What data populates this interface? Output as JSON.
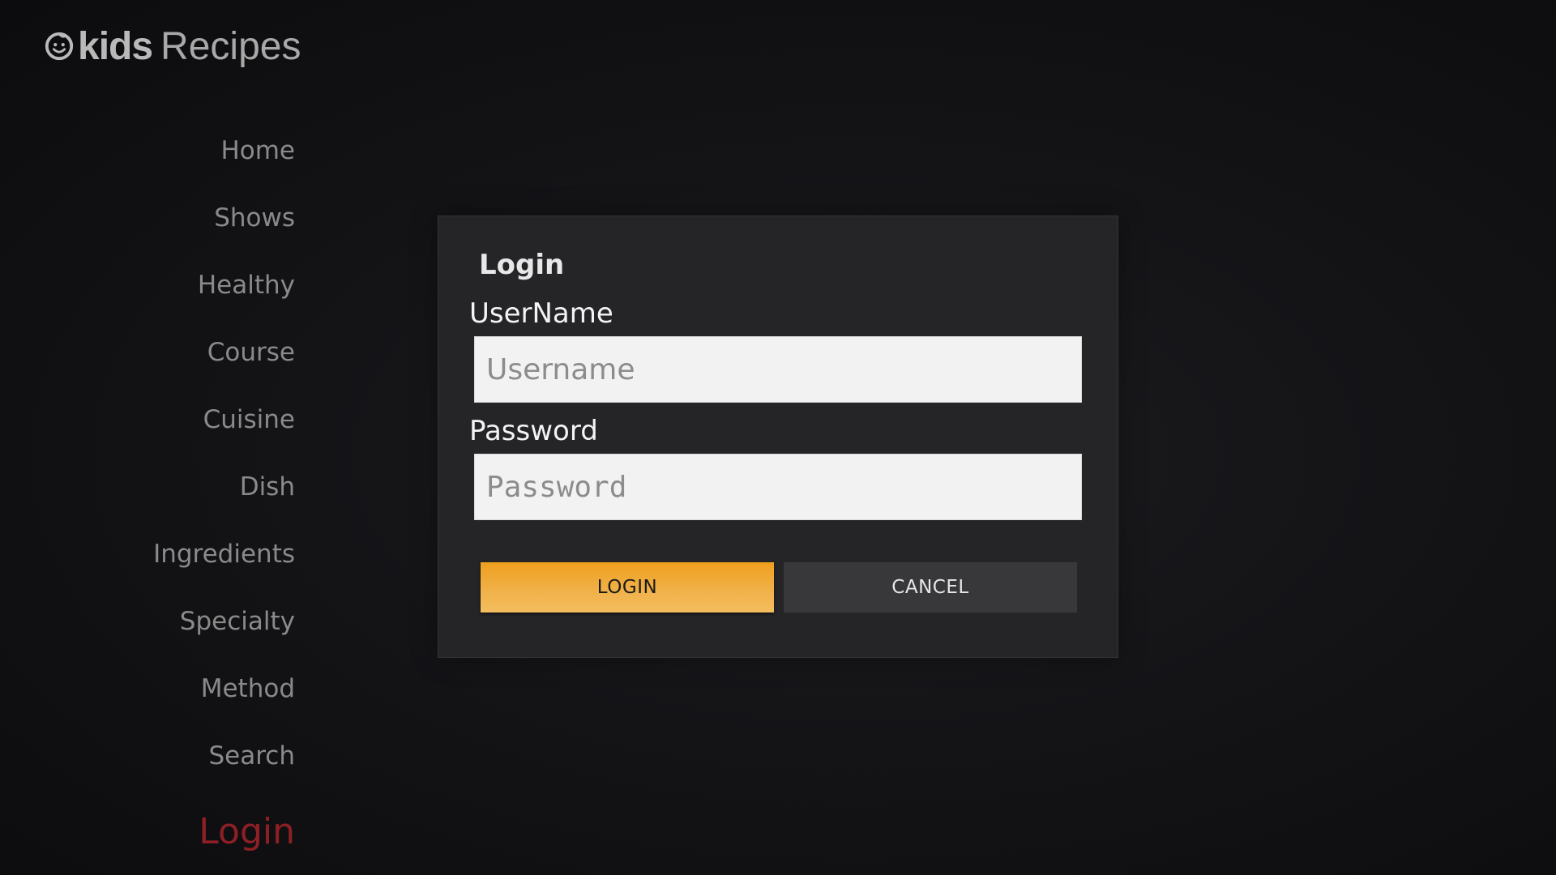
{
  "app": {
    "logo_icon": "kids-face-icon",
    "logo_kids": "kids",
    "logo_recipes": "Recipes"
  },
  "nav": {
    "items": [
      {
        "label": "Home"
      },
      {
        "label": "Shows"
      },
      {
        "label": "Healthy"
      },
      {
        "label": "Course"
      },
      {
        "label": "Cuisine"
      },
      {
        "label": "Dish"
      },
      {
        "label": "Ingredients"
      },
      {
        "label": "Specialty"
      },
      {
        "label": "Method"
      },
      {
        "label": "Search"
      },
      {
        "label": "Login",
        "active": true
      }
    ],
    "active_color": "#8e1f25"
  },
  "login_dialog": {
    "title": "Login",
    "username_label": "UserName",
    "username_placeholder": "Username",
    "username_value": "",
    "password_label": "Password",
    "password_placeholder": "Password",
    "password_value": "",
    "login_button": "LOGIN",
    "cancel_button": "CANCEL",
    "accent_color": "#f0a523"
  }
}
